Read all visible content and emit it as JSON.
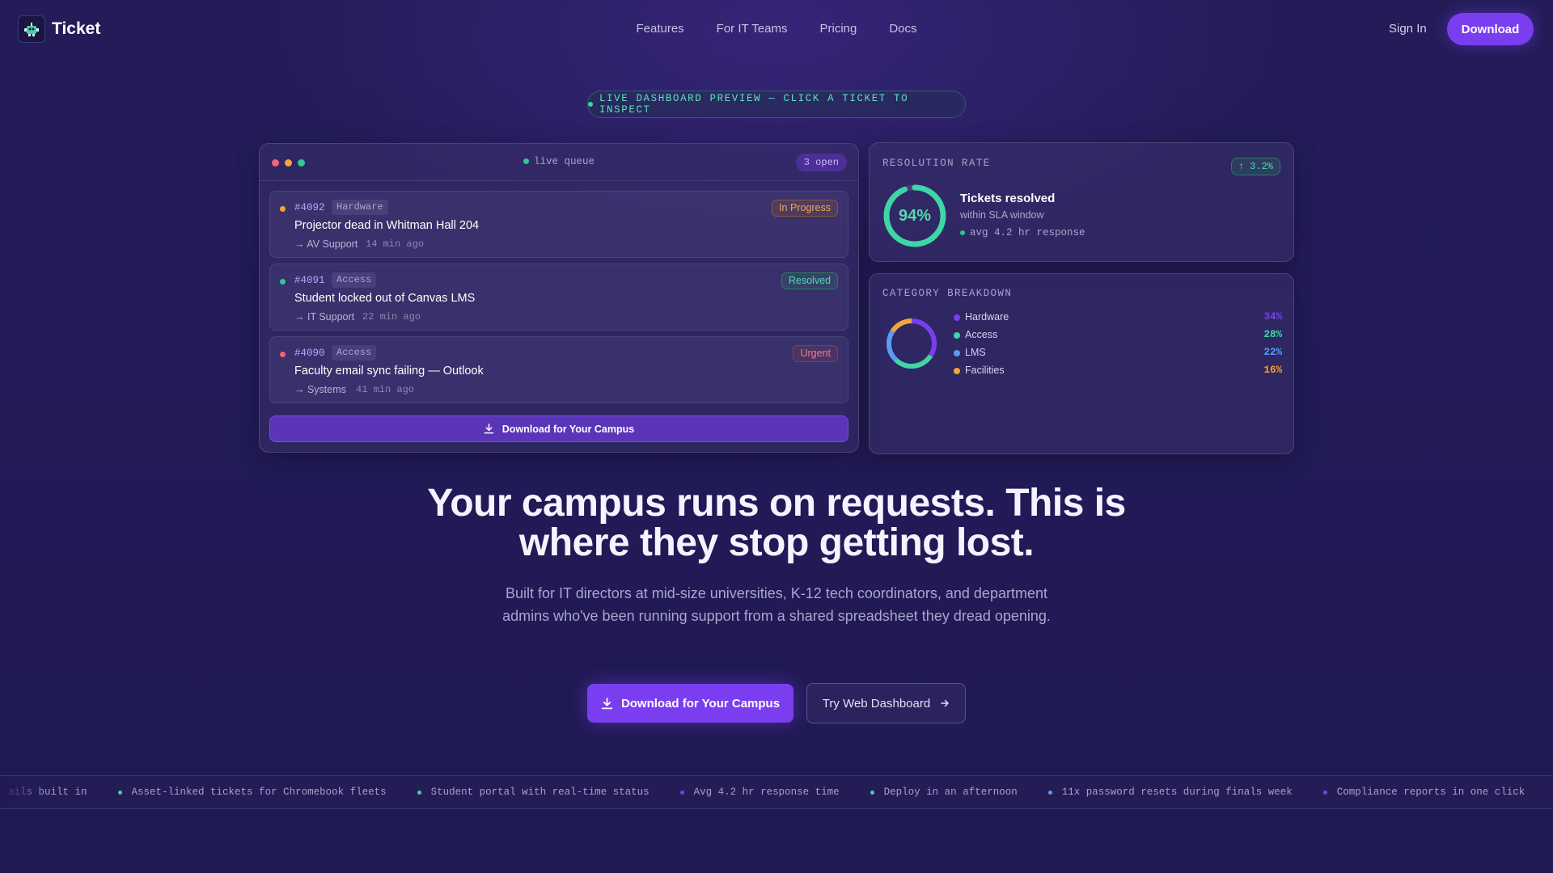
{
  "brand": {
    "name": "Ticket",
    "logo_icon": "robot-icon"
  },
  "nav": {
    "links": [
      "Features",
      "For IT Teams",
      "Pricing",
      "Docs"
    ],
    "sign_in": "Sign In",
    "download": "Download"
  },
  "preview_pill": "LIVE DASHBOARD PREVIEW — CLICK A TICKET TO INSPECT",
  "queue": {
    "title": "live queue",
    "open_count": "3 open",
    "tickets": [
      {
        "id": "#4092",
        "category": "Hardware",
        "title": "Projector dead in Whitman Hall 204",
        "team": "→ AV Support",
        "time": "14 min ago",
        "status": "In Progress",
        "dot_color": "#f5a43a"
      },
      {
        "id": "#4091",
        "category": "Access",
        "title": "Student locked out of Canvas LMS",
        "team": "→ IT Support",
        "time": "22 min ago",
        "status": "Resolved",
        "dot_color": "#2ec994"
      },
      {
        "id": "#4090",
        "category": "Access",
        "title": "Faculty email sync failing — Outlook",
        "team": "→ Systems",
        "time": "41 min ago",
        "status": "Urgent",
        "dot_color": "#f2647a"
      }
    ],
    "download_button": "Download for Your Campus"
  },
  "resolution": {
    "label": "RESOLUTION RATE",
    "change": "↑ 3.2%",
    "percent_text": "94%",
    "percent_value": 94,
    "title": "Tickets resolved",
    "subtitle": "within SLA window",
    "avg": "avg 4.2 hr response"
  },
  "category_breakdown": {
    "label": "CATEGORY BREAKDOWN",
    "items": [
      {
        "name": "Hardware",
        "value": "34%",
        "percent": 34,
        "color": "#7a3ef0"
      },
      {
        "name": "Access",
        "value": "28%",
        "percent": 28,
        "color": "#3dd6a4"
      },
      {
        "name": "LMS",
        "value": "22%",
        "percent": 22,
        "color": "#5b9cf5"
      },
      {
        "name": "Facilities",
        "value": "16%",
        "percent": 16,
        "color": "#f5a43a"
      }
    ]
  },
  "hero": {
    "headline_line1": "Your campus runs on requests. This is",
    "headline_line2": "where they stop getting lost.",
    "subtext": "Built for IT directors at mid-size universities, K-12 tech coordinators, and department admins who've been running support from a shared spreadsheet they dread opening.",
    "primary_cta": "Download for Your Campus",
    "secondary_cta": "Try Web Dashboard"
  },
  "ticker": {
    "lead_text": "ails built in",
    "items": [
      {
        "text": "Asset-linked tickets for Chromebook fleets",
        "color": "#3dd6a4"
      },
      {
        "text": "Student portal with real-time status",
        "color": "#3dd6a4"
      },
      {
        "text": "Avg 4.2 hr response time",
        "color": "#7a3ef0"
      },
      {
        "text": "Deploy in an afternoon",
        "color": "#3dd6a4"
      },
      {
        "text": "11x password resets during finals week",
        "color": "#5b9cf5"
      },
      {
        "text": "Compliance reports in one click",
        "color": "#7a3ef0"
      }
    ]
  }
}
